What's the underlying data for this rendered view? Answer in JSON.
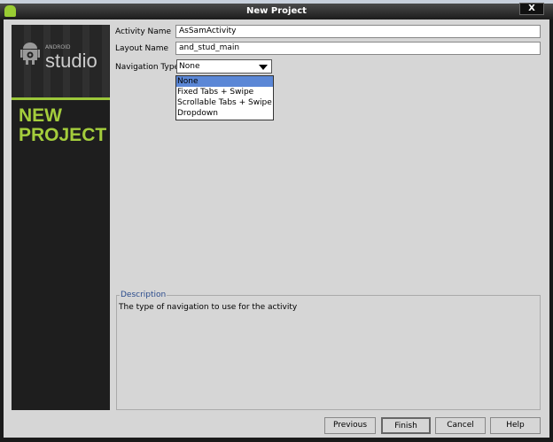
{
  "window": {
    "title": "New Project",
    "close_label": "X"
  },
  "sidebar": {
    "brand_small": "ANDROID",
    "brand": "studio",
    "heading_line1": "NEW",
    "heading_line2": "PROJECT"
  },
  "form": {
    "activity_name_label": "Activity Name",
    "activity_name_value": "AsSamActivity",
    "layout_name_label": "Layout Name",
    "layout_name_value": "and_stud_main",
    "navigation_type_label": "Navigation Type",
    "navigation_type_value": "None",
    "navigation_options": [
      "None",
      "Fixed Tabs + Swipe",
      "Scrollable Tabs + Swipe",
      "Dropdown"
    ]
  },
  "description": {
    "label": "Description",
    "text": "The type of navigation to use for the activity"
  },
  "buttons": {
    "previous": "Previous",
    "finish": "Finish",
    "cancel": "Cancel",
    "help": "Help"
  }
}
